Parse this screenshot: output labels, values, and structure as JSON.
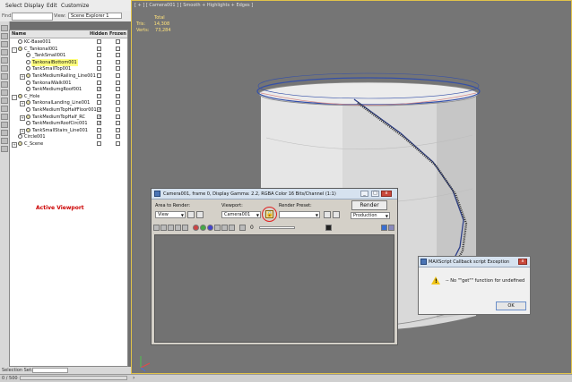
{
  "menu": [
    "Select",
    "Display",
    "Edit",
    "Customize"
  ],
  "find": {
    "label": "Find:",
    "value": ""
  },
  "explorer_selector": {
    "label": "View:",
    "value": "Scene Explorer 1"
  },
  "explorer": {
    "columns": {
      "name": "Name",
      "hidden": "Hidden",
      "frozen": "Frozen"
    },
    "rows": [
      {
        "name": "KC-Base001",
        "indent": 0,
        "exp": "",
        "sel": false,
        "hidden": false,
        "frozen": false
      },
      {
        "name": "C_Tankonal001",
        "indent": 0,
        "exp": "-",
        "sel": false,
        "hidden": false,
        "frozen": false
      },
      {
        "name": "_TankSmall001",
        "indent": 1,
        "exp": "",
        "sel": false,
        "hidden": false,
        "frozen": false
      },
      {
        "name": "TankonalBottom001",
        "indent": 1,
        "exp": "",
        "sel": true,
        "hidden": false,
        "frozen": false
      },
      {
        "name": "TankSmallTop001",
        "indent": 1,
        "exp": "",
        "sel": false,
        "hidden": false,
        "frozen": false
      },
      {
        "name": "TankMediumRailing_Line001",
        "indent": 1,
        "exp": "+",
        "sel": false,
        "hidden": false,
        "frozen": false
      },
      {
        "name": "TankonalWalk001",
        "indent": 1,
        "exp": "",
        "sel": false,
        "hidden": false,
        "frozen": false
      },
      {
        "name": "TankMediumgRoof001",
        "indent": 1,
        "exp": "",
        "sel": false,
        "hidden": true,
        "frozen": false
      },
      {
        "name": "C_Hole",
        "indent": 0,
        "exp": "-",
        "sel": false,
        "hidden": false,
        "frozen": false
      },
      {
        "name": "TankonalLanding_Line001",
        "indent": 1,
        "exp": "+",
        "sel": false,
        "hidden": false,
        "frozen": false
      },
      {
        "name": "TankMediumTopHalfFloor001",
        "indent": 1,
        "exp": "",
        "sel": false,
        "hidden": true,
        "frozen": false
      },
      {
        "name": "TankMediumTopHalf_RC",
        "indent": 1,
        "exp": "+",
        "sel": false,
        "hidden": true,
        "frozen": false
      },
      {
        "name": "TankMediumRoofCirc001",
        "indent": 1,
        "exp": "",
        "sel": false,
        "hidden": true,
        "frozen": false
      },
      {
        "name": "TankSmallStairs_Line001",
        "indent": 1,
        "exp": "+",
        "sel": false,
        "hidden": false,
        "frozen": false
      },
      {
        "name": "Circle001",
        "indent": 0,
        "exp": "",
        "sel": false,
        "hidden": false,
        "frozen": false
      },
      {
        "name": "C_Scene",
        "indent": 0,
        "exp": "+",
        "sel": false,
        "hidden": false,
        "frozen": false
      }
    ]
  },
  "annotation": "Active Viewport",
  "selection_set": {
    "label": "Selection Set:",
    "value": ""
  },
  "status": {
    "counter": "0 / 500",
    "progress": 0.0
  },
  "viewport": {
    "label": "[ + ] [ Camera001 ] [ Smooth + Highlights + Edges ]",
    "stats": {
      "total": "Total",
      "tris_label": "Tris:",
      "tris": "14,308",
      "verts_label": "Verts:",
      "verts": "73,284"
    }
  },
  "render_window": {
    "title": "Camera001, frame 0, Display Gamma: 2.2, RGBA Color 16 Bits/Channel (1:1)",
    "area_label": "Area to Render:",
    "area_value": "View",
    "viewport_label": "Viewport:",
    "viewport_value": "Camera001",
    "preset_label": "Render Preset:",
    "preset_value": "",
    "render_button": "Render",
    "production_value": "Production",
    "frame_value": "0"
  },
  "message_box": {
    "title": "MAXScript Callback script Exception",
    "message": "-- No \"\"get\"\" function for undefined",
    "ok_label": "OK"
  },
  "colors": {
    "viewport_bg": "#757575",
    "active_border": "#e1c34a",
    "selected_row": "#ffff7f",
    "annotation_red": "#cc0000"
  }
}
